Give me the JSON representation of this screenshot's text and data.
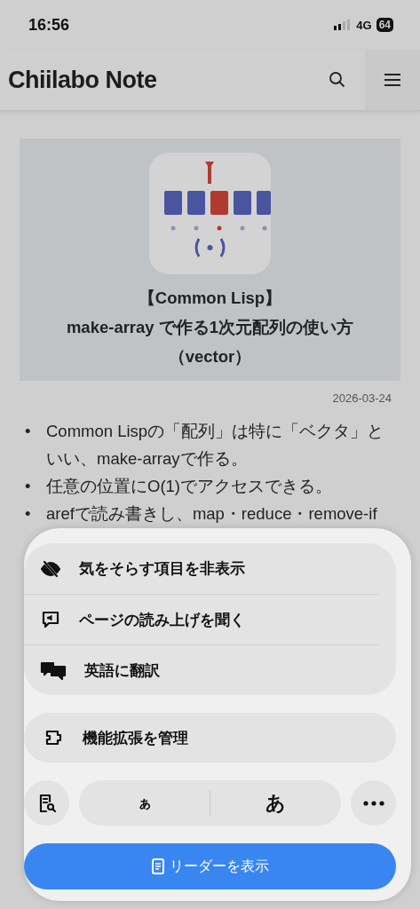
{
  "status_bar": {
    "time": "16:56",
    "network": "4G",
    "battery": "64"
  },
  "header": {
    "site_title": "Chiilabo Note"
  },
  "hero": {
    "title_lines": [
      "【Common Lisp】",
      "make-array で作る1次元配列の使い方",
      "（vector）"
    ]
  },
  "date": "2026-03-24",
  "bullets": [
    {
      "marker": "•",
      "text": "Common Lispの「配列」は特に「ベクタ」といい、make-arrayで作る。"
    },
    {
      "marker": "•",
      "text": "任意の位置にO(1)でアクセスできる。"
    },
    {
      "marker": "•",
      "text": "arefで読み書きし、map・reduce・remove-if"
    }
  ],
  "sheet": {
    "menu_items": [
      {
        "kind": "hide",
        "label": "気をそらす項目を非表示"
      },
      {
        "kind": "listen",
        "label": "ページの読み上げを聞く"
      },
      {
        "kind": "translate",
        "label": "英語に翻訳"
      }
    ],
    "extensions": {
      "label": "機能拡張を管理"
    },
    "text_size": {
      "smaller": "ぁ",
      "larger": "あ"
    },
    "reader_button": {
      "label": "リーダーを表示"
    }
  }
}
